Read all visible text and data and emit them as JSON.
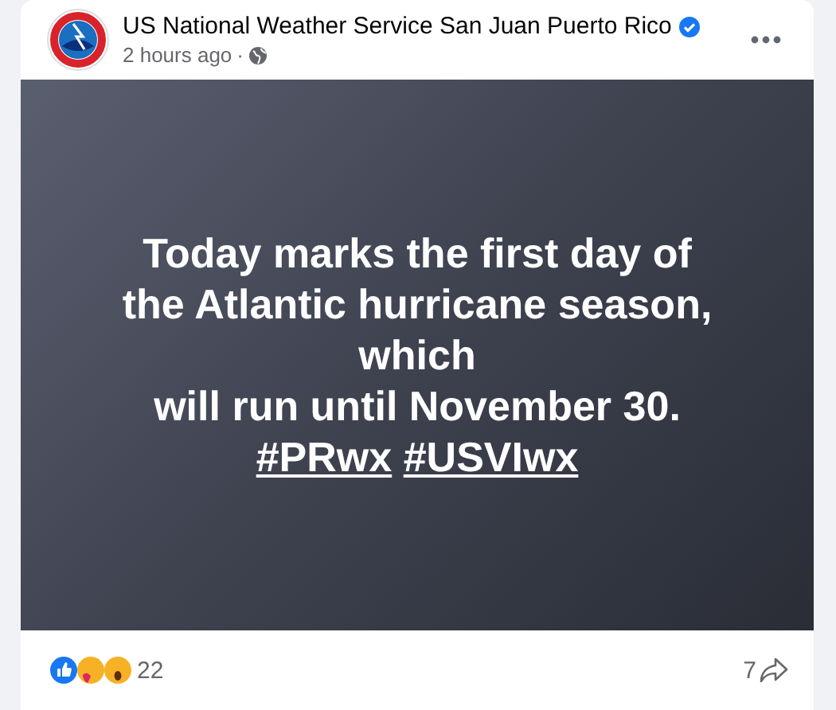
{
  "post": {
    "author": "US National Weather Service San Juan Puerto Rico",
    "verified": true,
    "time": "2 hours ago",
    "separator": "·",
    "image_text_lines": [
      "Today marks the first day of",
      "the Atlantic hurricane season,",
      "which",
      "will run until November 30."
    ],
    "hashtags": [
      "#PRwx",
      "#USVIwx"
    ],
    "reaction_count": "22",
    "share_count": "7"
  }
}
